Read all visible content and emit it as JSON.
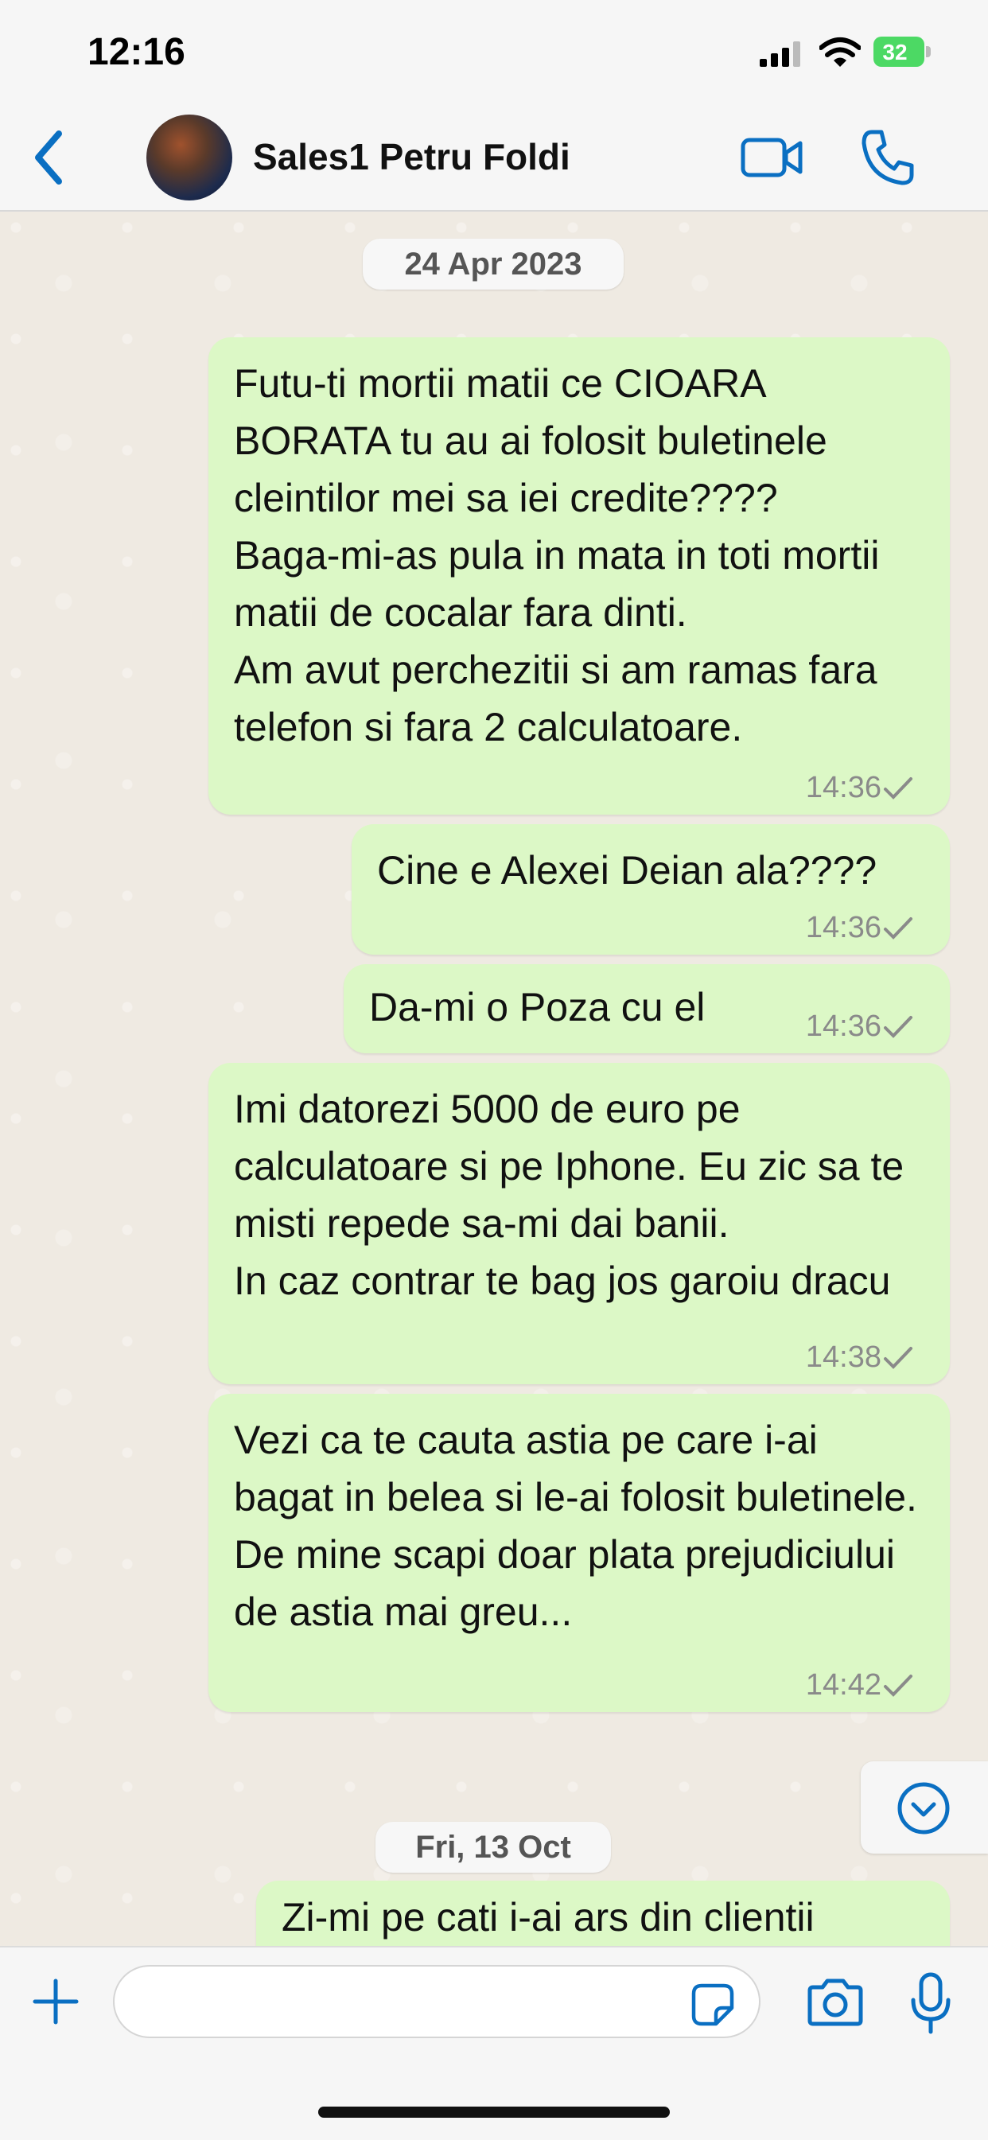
{
  "status_bar": {
    "time": "12:16",
    "battery": "32"
  },
  "header": {
    "contact_name": "Sales1 Petru Foldi"
  },
  "chat": {
    "date_separators": [
      "24 Apr 2023",
      "Fri, 13 Oct"
    ],
    "messages": [
      {
        "text": "Futu-ti mortii matii ce CIOARA BORATA tu au ai folosit buletinele cleintilor mei sa iei credite????\nBaga-mi-as pula in mata in toti mortii matii de cocalar fara dinti.\nAm avut perchezitii si am ramas fara telefon si fara 2 calculatoare.",
        "time": "14:36"
      },
      {
        "text": "Cine e Alexei Deian ala????",
        "time": "14:36"
      },
      {
        "text": "Da-mi o Poza cu el",
        "time": "14:36"
      },
      {
        "text": "Imi datorezi 5000 de euro pe calculatoare si pe Iphone. Eu zic sa te misti repede sa-mi dai banii.\nIn caz contrar te bag jos garoiu dracu",
        "time": "14:38"
      },
      {
        "text": "Vezi ca te cauta astia pe care i-ai bagat in belea si le-ai folosit buletinele. De mine scapi doar plata prejudiciului de astia mai greu...",
        "time": "14:42"
      },
      {
        "text": "Zi-mi pe cati i-ai ars din clientii",
        "time": ""
      }
    ]
  },
  "input": {
    "placeholder": ""
  },
  "colors": {
    "outgoing_bubble": "#dcf8c6",
    "accent": "#0a6fc2",
    "background": "#efeae2"
  },
  "icons": [
    "back-icon",
    "video-call-icon",
    "phone-icon",
    "check-icon",
    "chevron-down-icon",
    "plus-icon",
    "sticker-icon",
    "camera-icon",
    "microphone-icon"
  ]
}
